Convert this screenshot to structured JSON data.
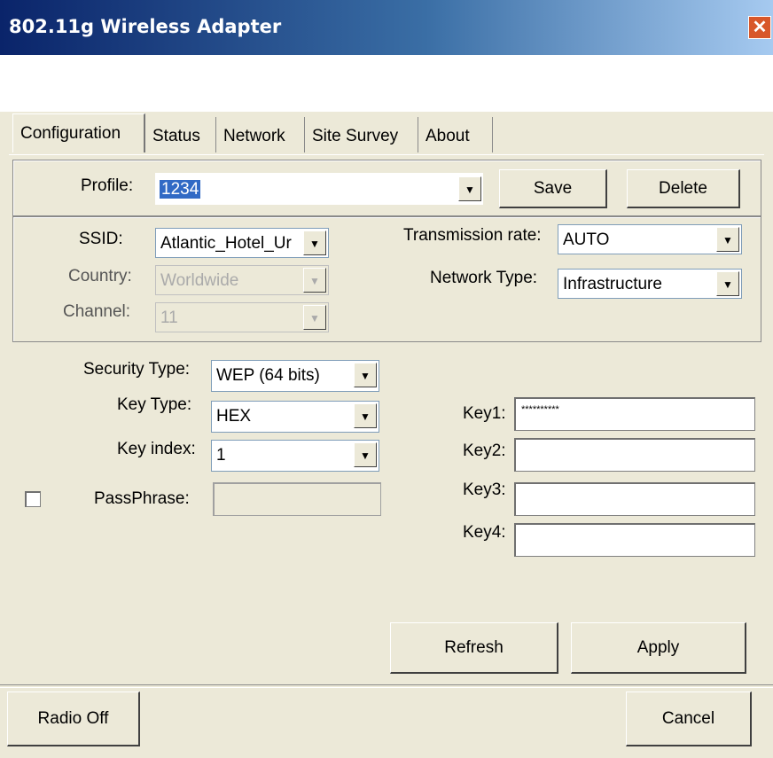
{
  "window": {
    "title": "802.11g Wireless Adapter",
    "close_icon": "close-icon"
  },
  "tabs": [
    {
      "label": "Configuration",
      "active": true
    },
    {
      "label": "Status",
      "active": false
    },
    {
      "label": "Network",
      "active": false
    },
    {
      "label": "Site Survey",
      "active": false
    },
    {
      "label": "About",
      "active": false
    }
  ],
  "profile": {
    "label": "Profile:",
    "value": "1234",
    "save_label": "Save",
    "delete_label": "Delete"
  },
  "ssid": {
    "label": "SSID:",
    "value": "Atlantic_Hotel_Ur"
  },
  "country": {
    "label": "Country:",
    "value": "Worldwide"
  },
  "channel": {
    "label": "Channel:",
    "value": "11"
  },
  "transmission_rate": {
    "label": "Transmission rate:",
    "value": "AUTO"
  },
  "network_type": {
    "label": "Network Type:",
    "value": "Infrastructure"
  },
  "security_type": {
    "label": "Security Type:",
    "value": "WEP (64 bits)"
  },
  "key_type": {
    "label": "Key Type:",
    "value": "HEX"
  },
  "key_index": {
    "label": "Key index:",
    "value": "1"
  },
  "passphrase": {
    "label": "PassPhrase:",
    "value": "",
    "checked": false
  },
  "keys": [
    {
      "label": "Key1:",
      "value": "**********"
    },
    {
      "label": "Key2:",
      "value": ""
    },
    {
      "label": "Key3:",
      "value": ""
    },
    {
      "label": "Key4:",
      "value": ""
    }
  ],
  "buttons": {
    "refresh": "Refresh",
    "apply": "Apply",
    "radio_off": "Radio Off",
    "cancel": "Cancel"
  },
  "colors": {
    "titlebar_start": "#0a246a",
    "titlebar_end": "#a6caf0",
    "dialog_bg": "#ece9d8",
    "selection": "#316ac5"
  }
}
